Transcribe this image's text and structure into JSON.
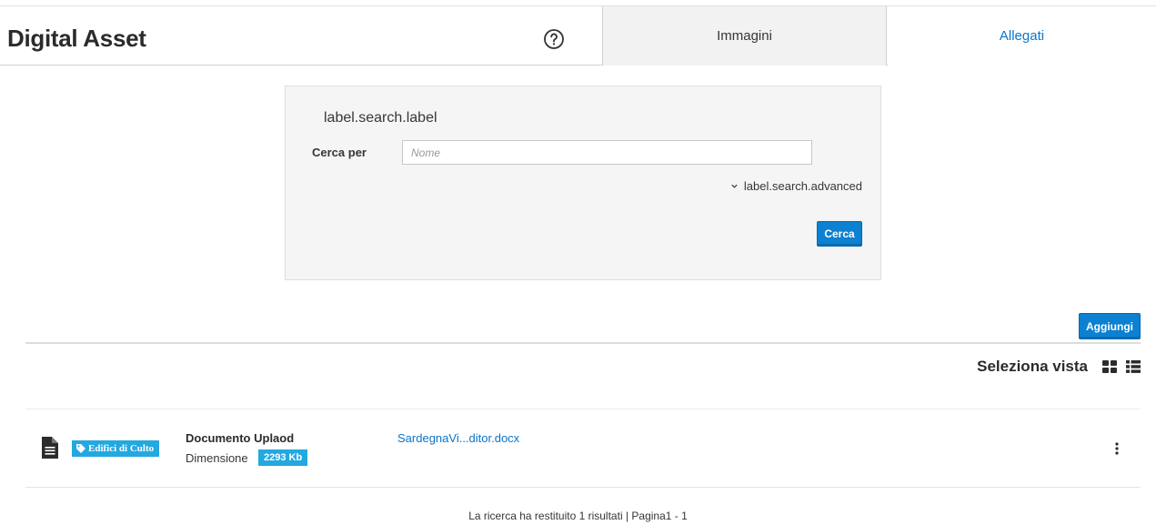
{
  "header": {
    "title": "Digital Asset",
    "help_icon": "help-circle-icon",
    "tabs": [
      {
        "label": "Immagini",
        "active": true
      },
      {
        "label": "Allegati",
        "active": false
      }
    ]
  },
  "search": {
    "heading": "label.search.label",
    "field_label": "Cerca per",
    "placeholder": "Nome",
    "value": "",
    "advanced_label": "label.search.advanced",
    "submit_label": "Cerca"
  },
  "toolbar": {
    "add_label": "Aggiungi",
    "view_label": "Seleziona vista",
    "view_icons": [
      "grid-icon",
      "list-icon"
    ]
  },
  "results": [
    {
      "icon": "document-icon",
      "category": "Edifici di Culto",
      "title": "Documento Uplaod",
      "size_label": "Dimensione",
      "size_value": "2293 Kb",
      "file_name": "SardegnaVi...ditor.docx"
    }
  ],
  "footer": {
    "summary": "La ricerca ha restituito 1 risultati | Pagina1 - 1"
  },
  "colors": {
    "primary": "#0c80d1",
    "link": "#0a74c9",
    "badge": "#23a8e0",
    "panel_bg": "#f5f5f5",
    "active_tab_bg": "#f2f2f2"
  }
}
